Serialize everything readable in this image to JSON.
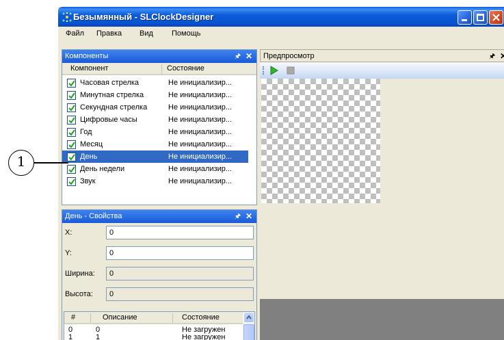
{
  "window": {
    "title": "Безымянный - SLClockDesigner"
  },
  "menu": [
    "Файл",
    "Правка",
    "Вид",
    "Помощь"
  ],
  "components_pane": {
    "title": "Компоненты",
    "col_component": "Компонент",
    "col_state": "Состояние",
    "rows": [
      {
        "name": "Часовая стрелка",
        "state": "Не инициализир...",
        "checked": true,
        "selected": false
      },
      {
        "name": "Минутная стрелка",
        "state": "Не инициализир...",
        "checked": true,
        "selected": false
      },
      {
        "name": "Секундная стрелка",
        "state": "Не инициализир...",
        "checked": true,
        "selected": false
      },
      {
        "name": "Цифровые часы",
        "state": "Не инициализир...",
        "checked": true,
        "selected": false
      },
      {
        "name": "Год",
        "state": "Не инициализир...",
        "checked": true,
        "selected": false
      },
      {
        "name": "Месяц",
        "state": "Не инициализир...",
        "checked": true,
        "selected": false
      },
      {
        "name": "День",
        "state": "Не инициализир...",
        "checked": true,
        "selected": true
      },
      {
        "name": "День недели",
        "state": "Не инициализир...",
        "checked": true,
        "selected": false
      },
      {
        "name": "Звук",
        "state": "Не инициализир...",
        "checked": true,
        "selected": false
      }
    ]
  },
  "properties_pane": {
    "title": "День - Свойства",
    "fields": [
      {
        "label": "X:",
        "value": "0",
        "readonly": false
      },
      {
        "label": "Y:",
        "value": "0",
        "readonly": false
      },
      {
        "label": "Ширина:",
        "value": "0",
        "readonly": true
      },
      {
        "label": "Высота:",
        "value": "0",
        "readonly": true
      }
    ],
    "frames": {
      "col_num": "#",
      "col_desc": "Описание",
      "col_state": "Состояние",
      "rows": [
        {
          "num": "0",
          "desc": "0",
          "state": "Не загружен"
        },
        {
          "num": "1",
          "desc": "1",
          "state": "Не загружен"
        }
      ]
    }
  },
  "preview_pane": {
    "title": "Предпросмотр"
  },
  "callout": {
    "number": "1"
  },
  "icons": [
    "app-icon",
    "minimize-icon",
    "maximize-icon",
    "close-icon",
    "pin-icon",
    "play-icon",
    "stop-icon",
    "checkbox-icon"
  ],
  "colors": {
    "titlebar": "#0754d2",
    "selection": "#316ac5",
    "pane_title_active": "#1a5ad8",
    "chrome": "#ece9d8"
  }
}
